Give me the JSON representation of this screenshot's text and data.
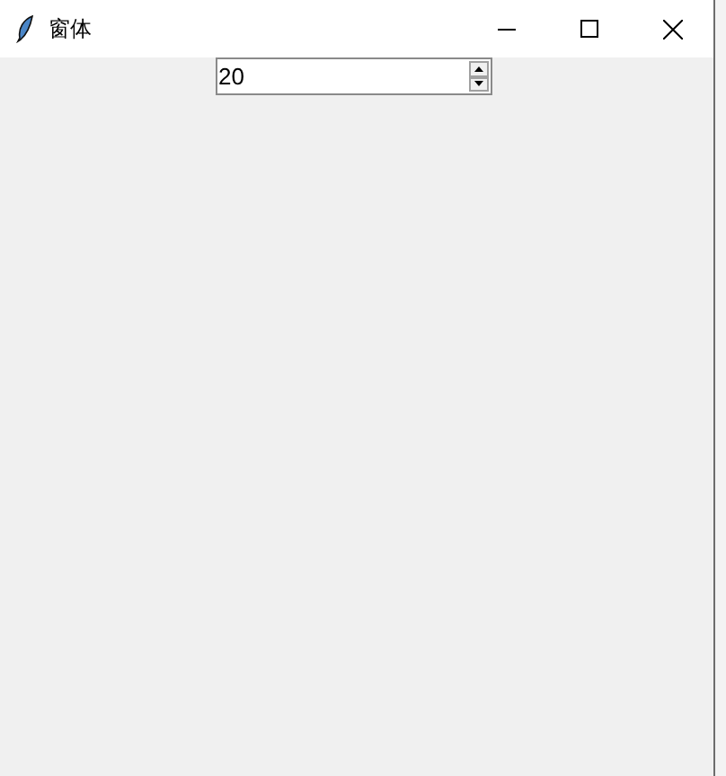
{
  "window": {
    "title": "窗体"
  },
  "spinbox": {
    "value": "20"
  }
}
